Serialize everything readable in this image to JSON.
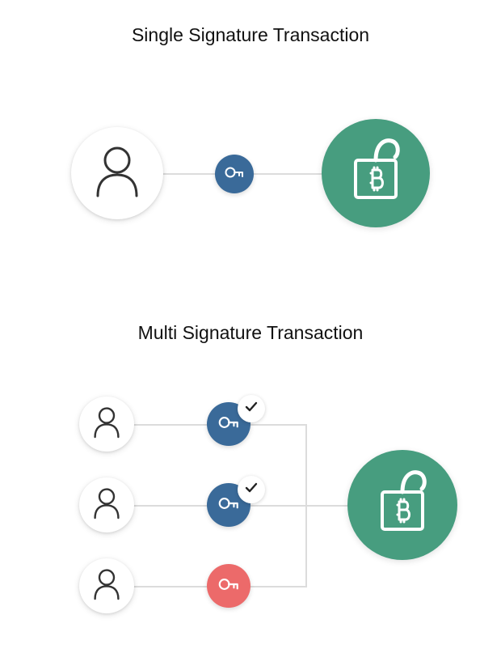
{
  "titles": {
    "single": "Single Signature Transaction",
    "multi": "Multi Signature Transaction"
  },
  "colors": {
    "key_valid": "#3a6a99",
    "key_invalid": "#ec6a6a",
    "unlock": "#479d7f",
    "line": "#dcdcdc",
    "text": "#111111"
  },
  "icons": {
    "user": "user-icon",
    "key": "key-icon",
    "check": "check-icon",
    "unlock_bitcoin": "unlock-bitcoin-icon"
  },
  "diagram": {
    "single": {
      "users": 1,
      "keys": [
        {
          "valid": true,
          "approved": null
        }
      ],
      "unlocked": true
    },
    "multi": {
      "users": 3,
      "keys": [
        {
          "valid": true,
          "approved": true
        },
        {
          "valid": true,
          "approved": true
        },
        {
          "valid": false,
          "approved": false
        }
      ],
      "unlocked": true,
      "required_signatures": 2
    }
  }
}
